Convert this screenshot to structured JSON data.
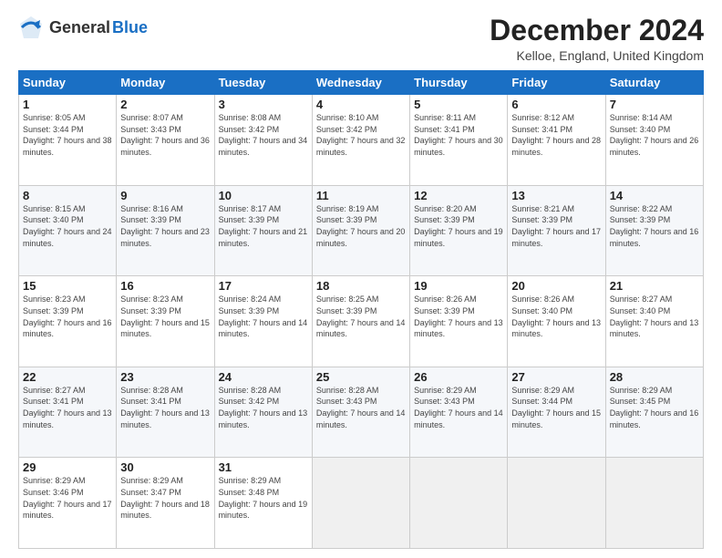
{
  "header": {
    "logo_general": "General",
    "logo_blue": "Blue",
    "month_title": "December 2024",
    "location": "Kelloe, England, United Kingdom"
  },
  "weekdays": [
    "Sunday",
    "Monday",
    "Tuesday",
    "Wednesday",
    "Thursday",
    "Friday",
    "Saturday"
  ],
  "weeks": [
    [
      {
        "day": "1",
        "sunrise": "Sunrise: 8:05 AM",
        "sunset": "Sunset: 3:44 PM",
        "daylight": "Daylight: 7 hours and 38 minutes."
      },
      {
        "day": "2",
        "sunrise": "Sunrise: 8:07 AM",
        "sunset": "Sunset: 3:43 PM",
        "daylight": "Daylight: 7 hours and 36 minutes."
      },
      {
        "day": "3",
        "sunrise": "Sunrise: 8:08 AM",
        "sunset": "Sunset: 3:42 PM",
        "daylight": "Daylight: 7 hours and 34 minutes."
      },
      {
        "day": "4",
        "sunrise": "Sunrise: 8:10 AM",
        "sunset": "Sunset: 3:42 PM",
        "daylight": "Daylight: 7 hours and 32 minutes."
      },
      {
        "day": "5",
        "sunrise": "Sunrise: 8:11 AM",
        "sunset": "Sunset: 3:41 PM",
        "daylight": "Daylight: 7 hours and 30 minutes."
      },
      {
        "day": "6",
        "sunrise": "Sunrise: 8:12 AM",
        "sunset": "Sunset: 3:41 PM",
        "daylight": "Daylight: 7 hours and 28 minutes."
      },
      {
        "day": "7",
        "sunrise": "Sunrise: 8:14 AM",
        "sunset": "Sunset: 3:40 PM",
        "daylight": "Daylight: 7 hours and 26 minutes."
      }
    ],
    [
      {
        "day": "8",
        "sunrise": "Sunrise: 8:15 AM",
        "sunset": "Sunset: 3:40 PM",
        "daylight": "Daylight: 7 hours and 24 minutes."
      },
      {
        "day": "9",
        "sunrise": "Sunrise: 8:16 AM",
        "sunset": "Sunset: 3:39 PM",
        "daylight": "Daylight: 7 hours and 23 minutes."
      },
      {
        "day": "10",
        "sunrise": "Sunrise: 8:17 AM",
        "sunset": "Sunset: 3:39 PM",
        "daylight": "Daylight: 7 hours and 21 minutes."
      },
      {
        "day": "11",
        "sunrise": "Sunrise: 8:19 AM",
        "sunset": "Sunset: 3:39 PM",
        "daylight": "Daylight: 7 hours and 20 minutes."
      },
      {
        "day": "12",
        "sunrise": "Sunrise: 8:20 AM",
        "sunset": "Sunset: 3:39 PM",
        "daylight": "Daylight: 7 hours and 19 minutes."
      },
      {
        "day": "13",
        "sunrise": "Sunrise: 8:21 AM",
        "sunset": "Sunset: 3:39 PM",
        "daylight": "Daylight: 7 hours and 17 minutes."
      },
      {
        "day": "14",
        "sunrise": "Sunrise: 8:22 AM",
        "sunset": "Sunset: 3:39 PM",
        "daylight": "Daylight: 7 hours and 16 minutes."
      }
    ],
    [
      {
        "day": "15",
        "sunrise": "Sunrise: 8:23 AM",
        "sunset": "Sunset: 3:39 PM",
        "daylight": "Daylight: 7 hours and 16 minutes."
      },
      {
        "day": "16",
        "sunrise": "Sunrise: 8:23 AM",
        "sunset": "Sunset: 3:39 PM",
        "daylight": "Daylight: 7 hours and 15 minutes."
      },
      {
        "day": "17",
        "sunrise": "Sunrise: 8:24 AM",
        "sunset": "Sunset: 3:39 PM",
        "daylight": "Daylight: 7 hours and 14 minutes."
      },
      {
        "day": "18",
        "sunrise": "Sunrise: 8:25 AM",
        "sunset": "Sunset: 3:39 PM",
        "daylight": "Daylight: 7 hours and 14 minutes."
      },
      {
        "day": "19",
        "sunrise": "Sunrise: 8:26 AM",
        "sunset": "Sunset: 3:39 PM",
        "daylight": "Daylight: 7 hours and 13 minutes."
      },
      {
        "day": "20",
        "sunrise": "Sunrise: 8:26 AM",
        "sunset": "Sunset: 3:40 PM",
        "daylight": "Daylight: 7 hours and 13 minutes."
      },
      {
        "day": "21",
        "sunrise": "Sunrise: 8:27 AM",
        "sunset": "Sunset: 3:40 PM",
        "daylight": "Daylight: 7 hours and 13 minutes."
      }
    ],
    [
      {
        "day": "22",
        "sunrise": "Sunrise: 8:27 AM",
        "sunset": "Sunset: 3:41 PM",
        "daylight": "Daylight: 7 hours and 13 minutes."
      },
      {
        "day": "23",
        "sunrise": "Sunrise: 8:28 AM",
        "sunset": "Sunset: 3:41 PM",
        "daylight": "Daylight: 7 hours and 13 minutes."
      },
      {
        "day": "24",
        "sunrise": "Sunrise: 8:28 AM",
        "sunset": "Sunset: 3:42 PM",
        "daylight": "Daylight: 7 hours and 13 minutes."
      },
      {
        "day": "25",
        "sunrise": "Sunrise: 8:28 AM",
        "sunset": "Sunset: 3:43 PM",
        "daylight": "Daylight: 7 hours and 14 minutes."
      },
      {
        "day": "26",
        "sunrise": "Sunrise: 8:29 AM",
        "sunset": "Sunset: 3:43 PM",
        "daylight": "Daylight: 7 hours and 14 minutes."
      },
      {
        "day": "27",
        "sunrise": "Sunrise: 8:29 AM",
        "sunset": "Sunset: 3:44 PM",
        "daylight": "Daylight: 7 hours and 15 minutes."
      },
      {
        "day": "28",
        "sunrise": "Sunrise: 8:29 AM",
        "sunset": "Sunset: 3:45 PM",
        "daylight": "Daylight: 7 hours and 16 minutes."
      }
    ],
    [
      {
        "day": "29",
        "sunrise": "Sunrise: 8:29 AM",
        "sunset": "Sunset: 3:46 PM",
        "daylight": "Daylight: 7 hours and 17 minutes."
      },
      {
        "day": "30",
        "sunrise": "Sunrise: 8:29 AM",
        "sunset": "Sunset: 3:47 PM",
        "daylight": "Daylight: 7 hours and 18 minutes."
      },
      {
        "day": "31",
        "sunrise": "Sunrise: 8:29 AM",
        "sunset": "Sunset: 3:48 PM",
        "daylight": "Daylight: 7 hours and 19 minutes."
      },
      null,
      null,
      null,
      null
    ]
  ]
}
